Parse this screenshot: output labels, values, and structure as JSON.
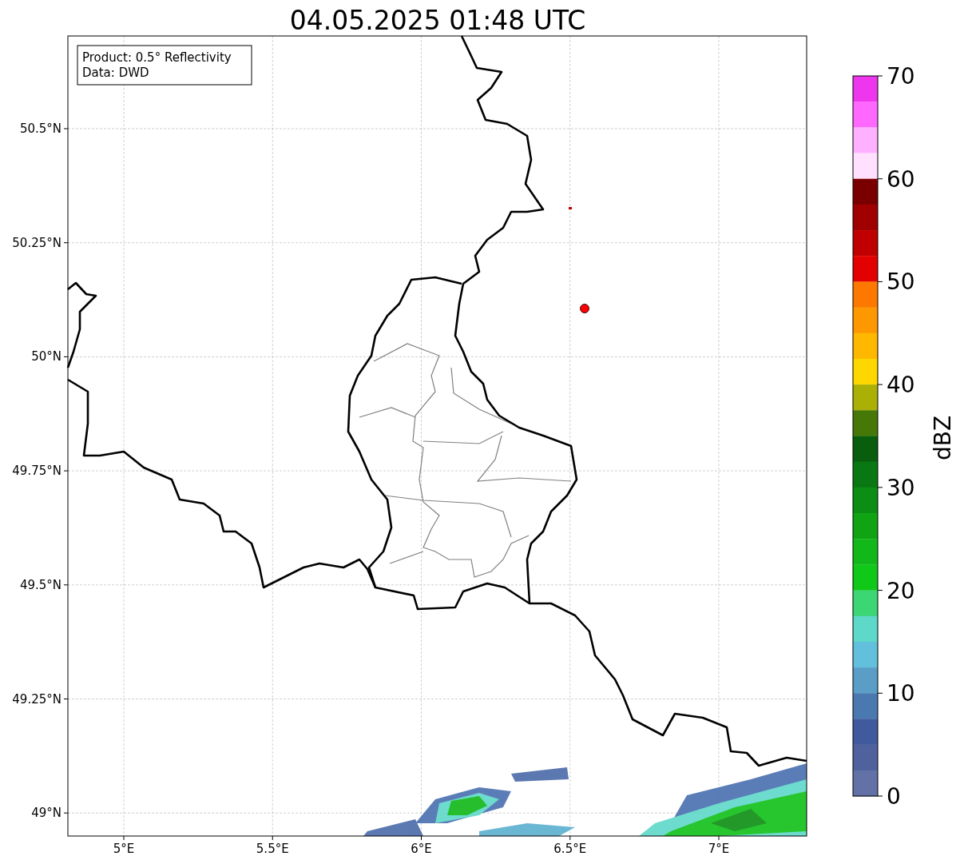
{
  "title": "04.05.2025 01:48 UTC",
  "info_box": [
    "Product: 0.5° Reflectivity",
    "Data: DWD"
  ],
  "map": {
    "x_ticks": [
      "5°E",
      "5.5°E",
      "6°E",
      "6.5°E",
      "7°E"
    ],
    "y_ticks": [
      "50.5°N",
      "50.25°N",
      "50°N",
      "49.75°N",
      "49.5°N",
      "49.25°N",
      "49°N"
    ]
  },
  "colorbar": {
    "label": "dBZ",
    "ticks": [
      "70",
      "60",
      "50",
      "40",
      "30",
      "20",
      "10",
      "0"
    ],
    "bins": [
      {
        "color": "#ee36ee"
      },
      {
        "color": "#ff68ff"
      },
      {
        "color": "#ffb0ff"
      },
      {
        "color": "#ffe0ff"
      },
      {
        "color": "#7a0000"
      },
      {
        "color": "#a00000"
      },
      {
        "color": "#c00000"
      },
      {
        "color": "#e20000"
      },
      {
        "color": "#fe7800"
      },
      {
        "color": "#fe9800"
      },
      {
        "color": "#feb800"
      },
      {
        "color": "#fed600"
      },
      {
        "color": "#aab006"
      },
      {
        "color": "#467808"
      },
      {
        "color": "#085e0c"
      },
      {
        "color": "#0a7812"
      },
      {
        "color": "#0c8e14"
      },
      {
        "color": "#10a414"
      },
      {
        "color": "#12b81a"
      },
      {
        "color": "#10c818"
      },
      {
        "color": "#3cd674"
      },
      {
        "color": "#5ed8c8"
      },
      {
        "color": "#62c0dc"
      },
      {
        "color": "#5a9ec8"
      },
      {
        "color": "#4a78b0"
      },
      {
        "color": "#405a9e"
      },
      {
        "color": "#50629e"
      },
      {
        "color": "#6272a6"
      }
    ]
  }
}
